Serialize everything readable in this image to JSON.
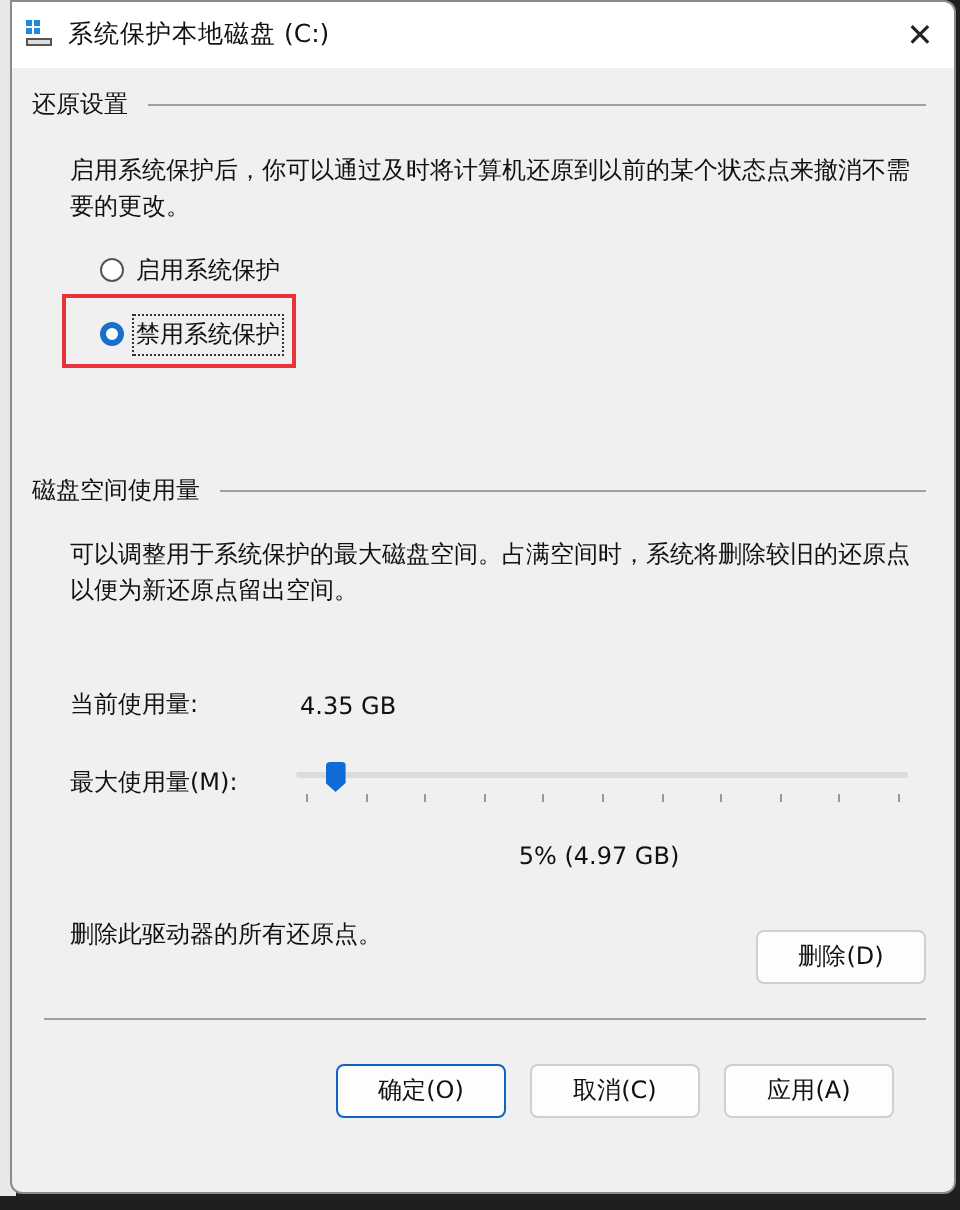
{
  "window": {
    "title": "系统保护本地磁盘 (C:)",
    "close": "✕"
  },
  "restore_settings": {
    "heading": "还原设置",
    "description": "启用系统保护后，你可以通过及时将计算机还原到以前的某个状态点来撤消不需要的更改。",
    "options": [
      {
        "label": "启用系统保护",
        "selected": false
      },
      {
        "label": "禁用系统保护",
        "selected": true,
        "highlighted": true
      }
    ]
  },
  "disk_usage": {
    "heading": "磁盘空间使用量",
    "description": "可以调整用于系统保护的最大磁盘空间。占满空间时，系统将删除较旧的还原点以便为新还原点留出空间。",
    "current_label": "当前使用量:",
    "current_value": "4.35 GB",
    "max_label": "最大使用量(M):",
    "slider": {
      "level": 0.05
    },
    "max_reading": "5% (4.97 GB)",
    "delete_text": "删除此驱动器的所有还原点。",
    "delete_button": "删除(D)"
  },
  "buttons": [
    {
      "label": "确定(O)",
      "default": true
    },
    {
      "label": "取消(C)",
      "default": false
    },
    {
      "label": "应用(A)",
      "default": false
    }
  ]
}
